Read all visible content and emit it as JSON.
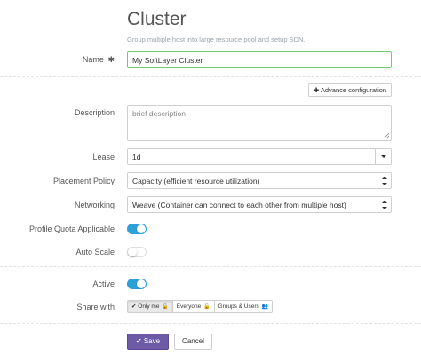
{
  "header": {
    "title": "Cluster",
    "subtitle": "Group multiple host into large resource pool and setup SDN."
  },
  "form": {
    "name": {
      "label": "Name",
      "required_mark": "✱",
      "value": "My SoftLayer Cluster"
    },
    "advanced_button": {
      "icon": "✚",
      "label": "Advance configuration"
    },
    "description": {
      "label": "Description",
      "placeholder": "brief description",
      "value": ""
    },
    "lease": {
      "label": "Lease",
      "value": "1d"
    },
    "placement_policy": {
      "label": "Placement Policy",
      "value": "Capacity (efficient resource utilization)"
    },
    "networking": {
      "label": "Networking",
      "value": "Weave (Container can connect to each other from multiple host)"
    },
    "profile_quota": {
      "label": "Profile Quota Applicable",
      "on": true
    },
    "auto_scale": {
      "label": "Auto Scale",
      "on": false
    },
    "active": {
      "label": "Active",
      "on": true
    },
    "share_with": {
      "label": "Share with",
      "options": [
        {
          "label": "Only me",
          "check": "✔",
          "icon": "🔒",
          "selected": true
        },
        {
          "label": "Everyone",
          "icon": "🔓",
          "selected": false
        },
        {
          "label": "Groups & Users",
          "icon": "👥",
          "selected": false
        }
      ]
    },
    "save_button": {
      "check": "✔",
      "label": "Save"
    },
    "cancel_button": {
      "label": "Cancel"
    }
  },
  "colors": {
    "accent": "#6d5ba8",
    "toggle_on": "#2d9fd9",
    "focus_border": "#73c96c"
  }
}
